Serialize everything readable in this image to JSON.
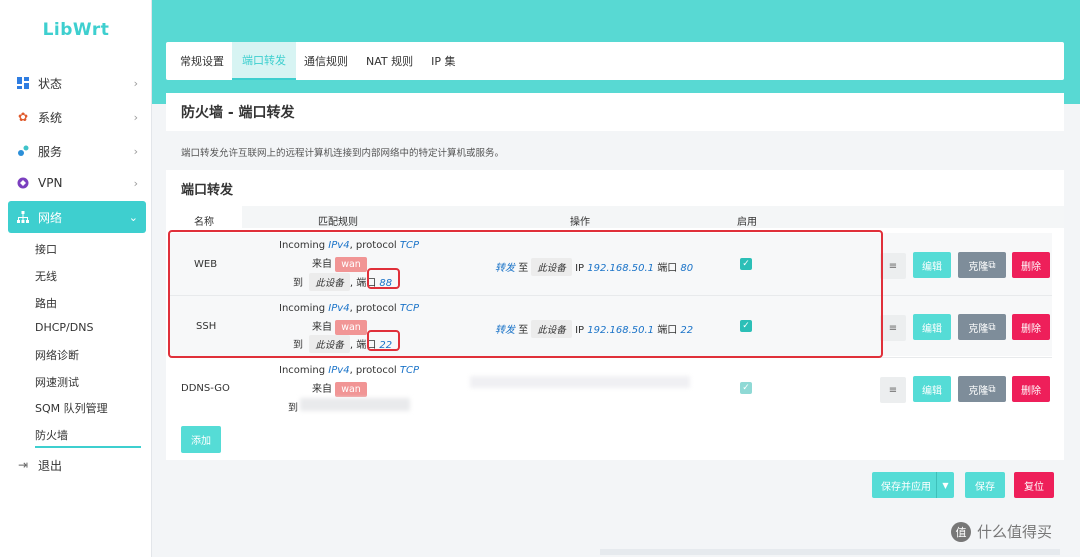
{
  "brand": "LibWrt",
  "sidebar": {
    "items": [
      {
        "label": "状态"
      },
      {
        "label": "系统"
      },
      {
        "label": "服务"
      },
      {
        "label": "VPN"
      },
      {
        "label": "网络"
      }
    ],
    "subitems": [
      "接口",
      "无线",
      "路由",
      "DHCP/DNS",
      "网络诊断",
      "网速测试",
      "SQM 队列管理",
      "防火墙"
    ],
    "logout": "退出"
  },
  "tabs": [
    "常规设置",
    "端口转发",
    "通信规则",
    "NAT 规则",
    "IP 集"
  ],
  "page_title": "防火墙 - 端口转发",
  "description": "端口转发允许互联网上的远程计算机连接到内部网络中的特定计算机或服务。",
  "section_title": "端口转发",
  "table": {
    "headers": [
      "名称",
      "匹配规则",
      "操作",
      "启用"
    ],
    "rows": [
      {
        "name": "WEB",
        "incoming": "Incoming",
        "ipver": "IPv4",
        "protocol_label": ", protocol",
        "protocol": "TCP",
        "from_label": "来自",
        "zone": "wan",
        "to_label": "到",
        "device": "此设备",
        "port_label": ", 端口",
        "port": "88",
        "fwd_label": "转发",
        "fwd_to": "至",
        "fwd_device": "此设备",
        "ip_label": "IP",
        "ip": "192.168.50.1",
        "port_label2": "端口",
        "fwd_port": "80",
        "enabled": true
      },
      {
        "name": "SSH",
        "incoming": "Incoming",
        "ipver": "IPv4",
        "protocol_label": ", protocol",
        "protocol": "TCP",
        "from_label": "来自",
        "zone": "wan",
        "to_label": "到",
        "device": "此设备",
        "port_label": ", 端口",
        "port": "22",
        "fwd_label": "转发",
        "fwd_to": "至",
        "fwd_device": "此设备",
        "ip_label": "IP",
        "ip": "192.168.50.1",
        "port_label2": "端口",
        "fwd_port": "22",
        "enabled": true
      },
      {
        "name": "DDNS-GO",
        "incoming": "Incoming",
        "ipver": "IPv4",
        "protocol_label": ", protocol",
        "protocol": "TCP",
        "from_label": "来自",
        "zone": "wan",
        "to_label": "到",
        "enabled": true
      }
    ],
    "buttons": {
      "sort": "≡",
      "edit": "编辑",
      "clone": "克隆",
      "delete": "删除"
    }
  },
  "add_button": "添加",
  "footer_buttons": {
    "save_apply": "保存并应用",
    "save": "保存",
    "reset": "复位"
  },
  "watermark": "什么值得买",
  "watermark_badge": "值",
  "colors": {
    "accent": "#3ecfcf",
    "danger": "#ee1f5a",
    "clone": "#7e8d9a",
    "wan_tag": "#f19595"
  }
}
